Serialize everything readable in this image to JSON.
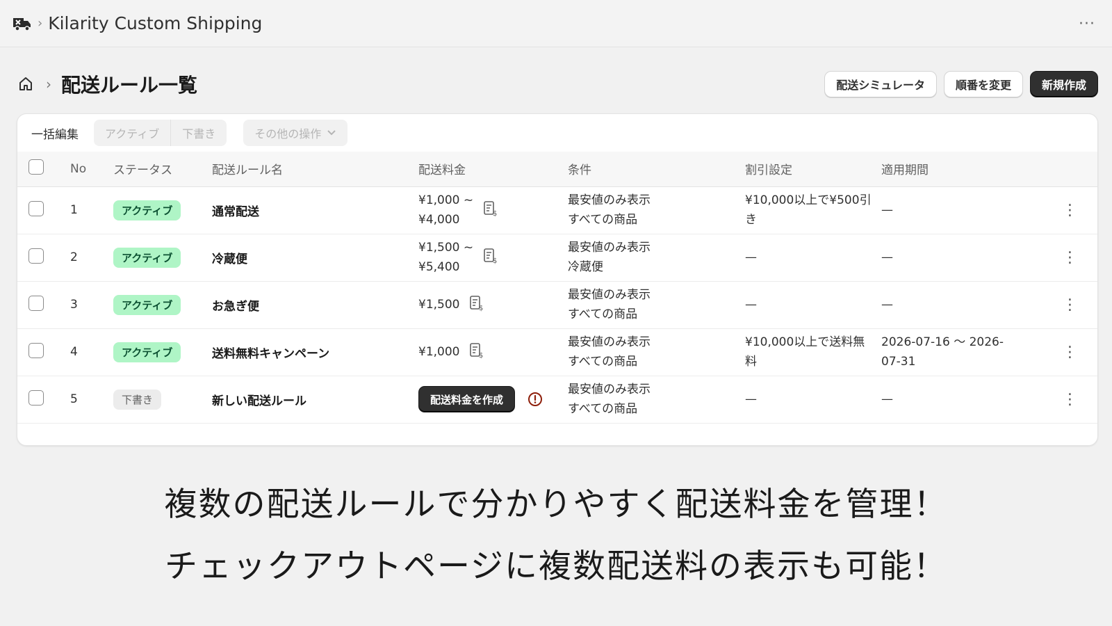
{
  "app": {
    "name": "Kilarity Custom Shipping",
    "icon": "delivery-truck-icon",
    "more": "···"
  },
  "page": {
    "title": "配送ルール一覧",
    "actions": {
      "simulator": "配送シミュレータ",
      "reorder": "順番を変更",
      "create": "新規作成"
    }
  },
  "bulk": {
    "label": "一括編集",
    "active": "アクティブ",
    "draft": "下書き",
    "more_ops": "その他の操作"
  },
  "table": {
    "headers": {
      "no": "No",
      "status": "ステータス",
      "name": "配送ルール名",
      "fee": "配送料金",
      "condition": "条件",
      "discount": "割引設定",
      "period": "適用期間"
    },
    "rows": [
      {
        "no": "1",
        "status": "アクティブ",
        "name": "通常配送",
        "fee_line1": "¥1,000 ~",
        "fee_line2": "¥4,000",
        "cond_line1": "最安値のみ表示",
        "cond_line2": "すべての商品",
        "disc_line1": "¥10,000以上で¥500引",
        "disc_line2": "き",
        "period_line1": "—",
        "period_line2": ""
      },
      {
        "no": "2",
        "status": "アクティブ",
        "name": "冷蔵便",
        "fee_line1": "¥1,500 ~",
        "fee_line2": "¥5,400",
        "cond_line1": "最安値のみ表示",
        "cond_line2": "冷蔵便",
        "disc_line1": "—",
        "disc_line2": "",
        "period_line1": "—",
        "period_line2": ""
      },
      {
        "no": "3",
        "status": "アクティブ",
        "name": "お急ぎ便",
        "fee_line1": "¥1,500",
        "fee_line2": "",
        "cond_line1": "最安値のみ表示",
        "cond_line2": "すべての商品",
        "disc_line1": "—",
        "disc_line2": "",
        "period_line1": "—",
        "period_line2": ""
      },
      {
        "no": "4",
        "status": "アクティブ",
        "name": "送料無料キャンペーン",
        "fee_line1": "¥1,000",
        "fee_line2": "",
        "cond_line1": "最安値のみ表示",
        "cond_line2": "すべての商品",
        "disc_line1": "¥10,000以上で送料無",
        "disc_line2": "料",
        "period_line1": "2026-07-16 〜 2026-",
        "period_line2": "07-31"
      },
      {
        "no": "5",
        "status": "下書き",
        "name": "新しい配送ルール",
        "fee_button": "配送料金を作成",
        "cond_line1": "最安値のみ表示",
        "cond_line2": "すべての商品",
        "disc_line1": "—",
        "disc_line2": "",
        "period_line1": "—",
        "period_line2": ""
      }
    ]
  },
  "promo": {
    "line1": "複数の配送ルールで分かりやすく配送料金を管理！",
    "line2": "チェックアウトページに複数配送料の表示も可能！"
  },
  "colors": {
    "active_badge_bg": "#aff5c6",
    "active_badge_fg": "#0c5132",
    "primary_button": "#303030",
    "warning": "#8e1f0b"
  }
}
